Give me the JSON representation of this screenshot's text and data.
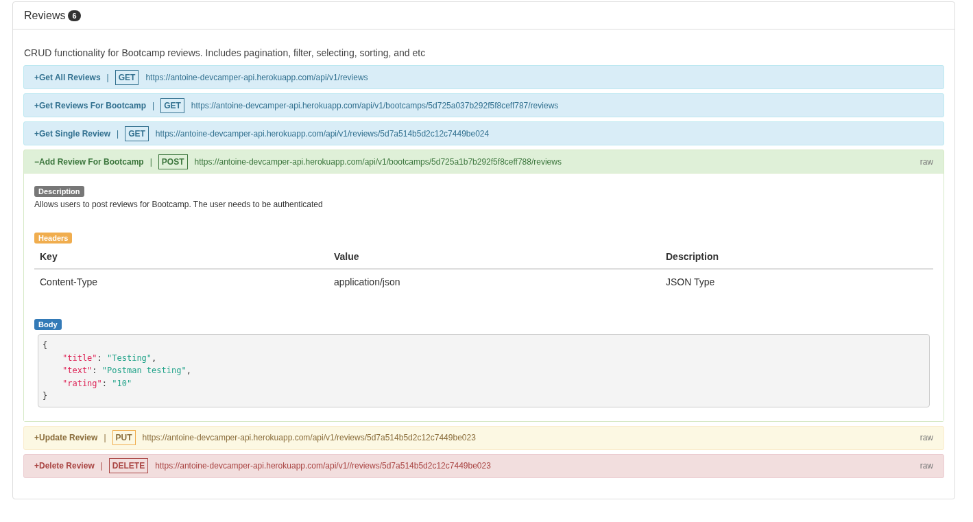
{
  "section": {
    "title": "Reviews",
    "count": "6",
    "description": "CRUD functionality for Bootcamp reviews. Includes pagination, filter, selecting, sorting, and etc"
  },
  "endpoints": [
    {
      "title": "+Get All Reviews",
      "separator": "|",
      "method": "GET",
      "url": "https://antoine-devcamper-api.herokuapp.com/api/v1/reviews",
      "expanded": false
    },
    {
      "title": "+Get Reviews For Bootcamp",
      "separator": "|",
      "method": "GET",
      "url": "https://antoine-devcamper-api.herokuapp.com/api/v1/bootcamps/5d725a037b292f5f8ceff787/reviews",
      "expanded": false
    },
    {
      "title": "+Get Single Review",
      "separator": "|",
      "method": "GET",
      "url": "https://antoine-devcamper-api.herokuapp.com/api/v1/reviews/5d7a514b5d2c12c7449be024",
      "expanded": false
    },
    {
      "title": "−Add Review For Bootcamp",
      "separator": "|",
      "method": "POST",
      "url": "https://antoine-devcamper-api.herokuapp.com/api/v1/bootcamps/5d725a1b7b292f5f8ceff788/reviews",
      "raw": "raw",
      "expanded": true,
      "details": {
        "description_label": "Description",
        "description": "Allows users to post reviews for Bootcamp. The user needs to be authenticated",
        "headers_label": "Headers",
        "headers": {
          "columns": [
            "Key",
            "Value",
            "Description"
          ],
          "rows": [
            [
              "Content-Type",
              "application/json",
              "JSON Type"
            ]
          ]
        },
        "body_label": "Body",
        "body": {
          "open": "{",
          "close": "}",
          "entries": [
            {
              "key": "\"title\"",
              "colon": ":",
              "value": "\"Testing\"",
              "comma": ","
            },
            {
              "key": "\"text\"",
              "colon": ":",
              "value": "\"Postman testing\"",
              "comma": ","
            },
            {
              "key": "\"rating\"",
              "colon": ":",
              "value": "\"10\""
            }
          ]
        }
      }
    },
    {
      "title": "+Update Review",
      "separator": "|",
      "method": "PUT",
      "url": "https://antoine-devcamper-api.herokuapp.com/api/v1/reviews/5d7a514b5d2c12c7449be023",
      "raw": "raw",
      "expanded": false
    },
    {
      "title": "+Delete Review",
      "separator": "|",
      "method": "DELETE",
      "url": "https://antoine-devcamper-api.herokuapp.com/api/v1//reviews/5d7a514b5d2c12c7449be023",
      "raw": "raw",
      "expanded": false
    }
  ]
}
